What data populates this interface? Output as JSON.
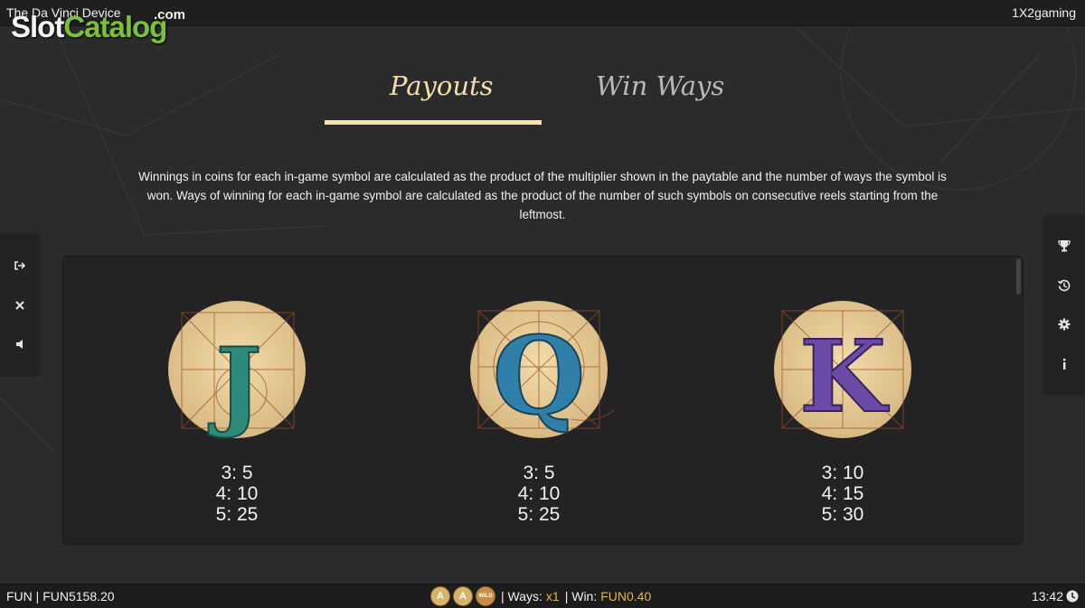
{
  "window": {
    "title": "The Da Vinci Device",
    "provider": "1X2gaming"
  },
  "watermark": {
    "part1": "Slot",
    "part2": "Catalog",
    "suffix": ".com"
  },
  "tabs": [
    {
      "label": "Payouts",
      "active": true
    },
    {
      "label": "Win Ways",
      "active": false
    }
  ],
  "description": "Winnings in coins for each in-game symbol are calculated as the product of the multiplier shown in the paytable and the number of ways the symbol is won. Ways of winning for each in-game symbol are calculated as the product of the number of such symbols on consecutive reels starting from the leftmost.",
  "left_controls": [
    {
      "icon": "exit-icon"
    },
    {
      "icon": "close-icon"
    },
    {
      "icon": "sound-icon"
    }
  ],
  "right_controls": [
    {
      "icon": "trophy-icon"
    },
    {
      "icon": "history-icon"
    },
    {
      "icon": "gear-icon"
    },
    {
      "icon": "info-icon"
    }
  ],
  "symbols": [
    {
      "letter": "J",
      "color": "#2e8a7a",
      "payouts": [
        "3: 5",
        "4: 10",
        "5: 25"
      ]
    },
    {
      "letter": "Q",
      "color": "#2f7fa8",
      "payouts": [
        "3: 5",
        "4: 10",
        "5: 25"
      ]
    },
    {
      "letter": "K",
      "color": "#6a4aa6",
      "payouts": [
        "3: 10",
        "4: 15",
        "5: 30"
      ]
    }
  ],
  "status": {
    "balance": "FUN | FUN5158.20",
    "coins": [
      "A",
      "A",
      "WILD"
    ],
    "ways_label": "| Ways:",
    "ways_value": "x1",
    "win_label": "| Win:",
    "win_value": "FUN0.40",
    "time": "13:42"
  },
  "colors": {
    "accent": "#e7b54a",
    "tab_active": "#f3dfae",
    "tab_inactive": "#b9b9b9"
  }
}
